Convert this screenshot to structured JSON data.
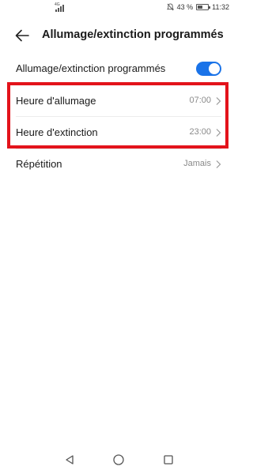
{
  "status_bar": {
    "network": "4G",
    "battery_percent_text": "43 %",
    "battery_level": 0.43,
    "time": "11:32"
  },
  "header": {
    "title": "Allumage/extinction programmés"
  },
  "settings": {
    "master_toggle": {
      "label": "Allumage/extinction programmés",
      "enabled": true
    },
    "power_on": {
      "label": "Heure d'allumage",
      "value": "07:00"
    },
    "power_off": {
      "label": "Heure d'extinction",
      "value": "23:00"
    },
    "repeat": {
      "label": "Répétition",
      "value": "Jamais"
    }
  },
  "colors": {
    "accent": "#1a73e8",
    "highlight": "#e3131b"
  },
  "icons": [
    "arrow-left-icon",
    "chevron-right-icon",
    "mute-bell-icon",
    "battery-icon",
    "signal-icon",
    "nav-back-icon",
    "nav-home-icon",
    "nav-recents-icon"
  ]
}
